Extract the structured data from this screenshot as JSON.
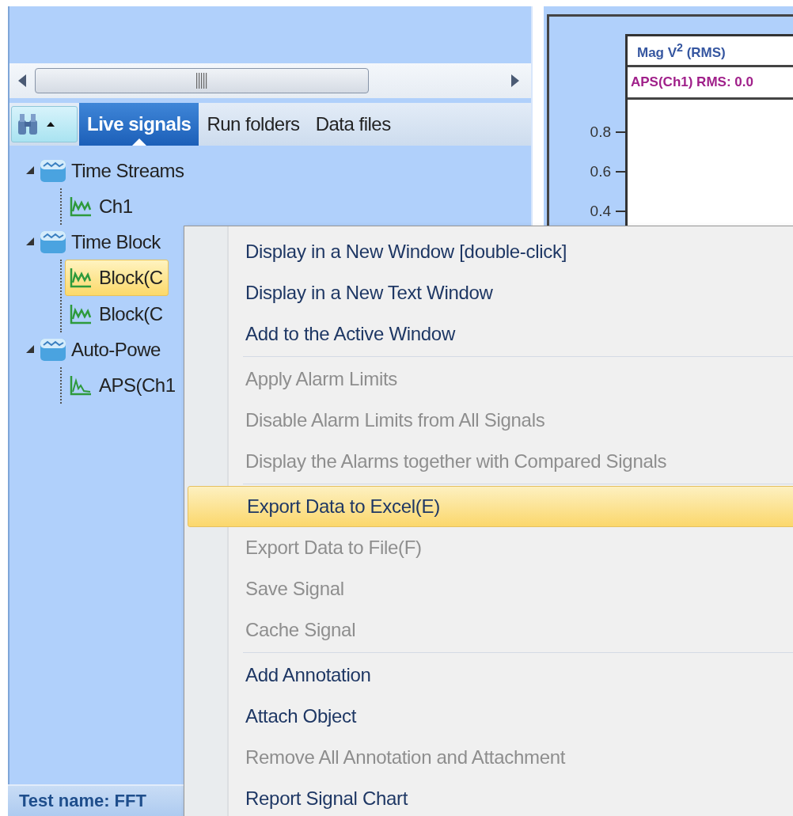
{
  "left_panel": {
    "tabs": [
      {
        "label": "Live signals",
        "selected": true
      },
      {
        "label": "Run folders",
        "selected": false
      },
      {
        "label": "Data files",
        "selected": false
      }
    ],
    "tree": [
      {
        "label": "Time Streams",
        "expanded": true,
        "children": [
          {
            "label": "Ch1",
            "selected": false,
            "kind": "wave"
          }
        ]
      },
      {
        "label": "Time Block",
        "expanded": true,
        "children": [
          {
            "label": "Block(C",
            "selected": true,
            "kind": "wave"
          },
          {
            "label": "Block(C",
            "selected": false,
            "kind": "wave"
          }
        ]
      },
      {
        "label": "Auto-Powe",
        "expanded": true,
        "children": [
          {
            "label": "APS(Ch1",
            "selected": false,
            "kind": "spectrum"
          }
        ]
      }
    ],
    "status_bar": "Test name: FFT"
  },
  "chart_panel": {
    "header": "Mag V$^{2}$ (RMS)",
    "legend": "APS(Ch1) RMS: 0.0",
    "y_ticks": [
      "0.8",
      "0.6",
      "0.4"
    ]
  },
  "context_menu": [
    {
      "kind": "item",
      "label": "Display in a New Window [double-click]",
      "disabled": false,
      "selected": false
    },
    {
      "kind": "item",
      "label": "Display in a New Text Window",
      "disabled": false,
      "selected": false
    },
    {
      "kind": "item",
      "label": "Add to the Active Window",
      "disabled": false,
      "selected": false
    },
    {
      "kind": "separator"
    },
    {
      "kind": "item",
      "label": "Apply Alarm Limits",
      "disabled": true,
      "selected": false
    },
    {
      "kind": "item",
      "label": "Disable Alarm Limits from All Signals",
      "disabled": true,
      "selected": false
    },
    {
      "kind": "item",
      "label": "Display the Alarms together with Compared Signals",
      "disabled": true,
      "selected": false
    },
    {
      "kind": "separator"
    },
    {
      "kind": "item",
      "label": "Export Data to Excel(E)",
      "disabled": false,
      "selected": true
    },
    {
      "kind": "item",
      "label": "Export Data to File(F)",
      "disabled": true,
      "selected": false
    },
    {
      "kind": "item",
      "label": "Save Signal",
      "disabled": true,
      "selected": false
    },
    {
      "kind": "item",
      "label": "Cache Signal",
      "disabled": true,
      "selected": false
    },
    {
      "kind": "separator"
    },
    {
      "kind": "item",
      "label": "Add Annotation",
      "disabled": false,
      "selected": false
    },
    {
      "kind": "item",
      "label": "Attach Object",
      "disabled": false,
      "selected": false
    },
    {
      "kind": "item",
      "label": "Remove All Annotation and Attachment",
      "disabled": true,
      "selected": false
    },
    {
      "kind": "item",
      "label": "Report Signal Chart",
      "disabled": false,
      "selected": false
    }
  ]
}
